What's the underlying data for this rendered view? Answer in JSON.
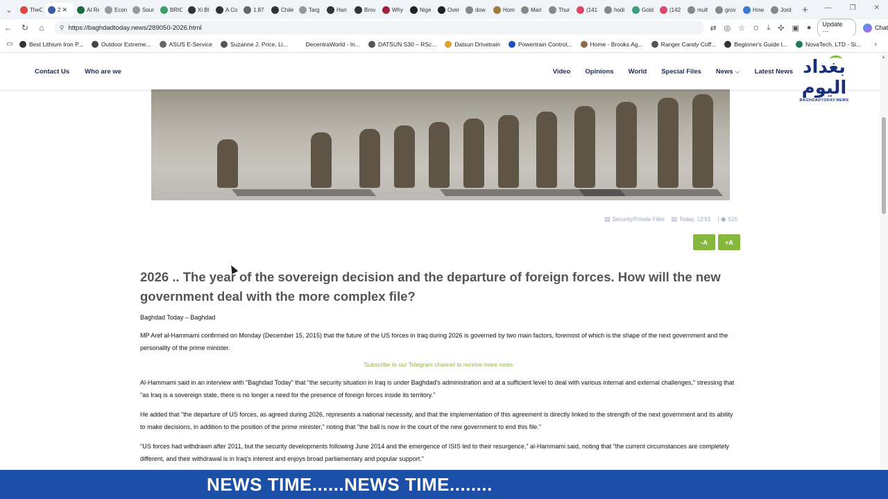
{
  "browser": {
    "tabs": [
      {
        "label": "TheC",
        "icon": "z-icon",
        "color": "#e0453b"
      },
      {
        "label": "2",
        "icon": "site-icon",
        "color": "#3a5aa8",
        "active": true
      },
      {
        "label": "AI Re",
        "icon": "ai-icon",
        "color": "#1d6b3a"
      },
      {
        "label": "Econ",
        "icon": "loading-icon",
        "color": "#999999"
      },
      {
        "label": "Sour",
        "icon": "loading-icon",
        "color": "#999999"
      },
      {
        "label": "BRIC",
        "icon": "globe-icon",
        "color": "#39a06a"
      },
      {
        "label": "Xi Bl",
        "icon": "x-icon",
        "color": "#333333"
      },
      {
        "label": "A Co",
        "icon": "o-icon",
        "color": "#333333"
      },
      {
        "label": "1.87",
        "icon": "globe-icon",
        "color": "#666666"
      },
      {
        "label": "Chile",
        "icon": "o-icon",
        "color": "#333333"
      },
      {
        "label": "Targ",
        "icon": "loading-icon",
        "color": "#999999"
      },
      {
        "label": "Han",
        "icon": "o-icon",
        "color": "#333333"
      },
      {
        "label": "Brov",
        "icon": "o-icon",
        "color": "#333333"
      },
      {
        "label": "Why",
        "icon": "red-icon",
        "color": "#a0203a"
      },
      {
        "label": "Nige",
        "icon": "dark-icon",
        "color": "#222222"
      },
      {
        "label": "Over",
        "icon": "dark-icon",
        "color": "#222222"
      },
      {
        "label": "dow",
        "icon": "search-icon",
        "color": "#888888"
      },
      {
        "label": "Hom",
        "icon": "bird-icon",
        "color": "#a07a3a"
      },
      {
        "label": "Mari",
        "icon": "search-icon",
        "color": "#888888"
      },
      {
        "label": "Thur",
        "icon": "globe-icon",
        "color": "#888888"
      },
      {
        "label": "(141",
        "icon": "youtube-icon",
        "color": "#e0456a"
      },
      {
        "label": "hodi",
        "icon": "search-icon",
        "color": "#888888"
      },
      {
        "label": "Gold",
        "icon": "green-icon",
        "color": "#3aa07a"
      },
      {
        "label": "(142",
        "icon": "youtube-icon",
        "color": "#e0456a"
      },
      {
        "label": "mult",
        "icon": "search-icon",
        "color": "#888888"
      },
      {
        "label": "grov",
        "icon": "search-icon",
        "color": "#888888"
      },
      {
        "label": "How",
        "icon": "blue-icon",
        "color": "#3a7ad0"
      },
      {
        "label": "Jord",
        "icon": "search-icon",
        "color": "#888888"
      }
    ],
    "url": "https://baghdadtoday.news/289050-2026.html",
    "update_label": "Update",
    "chat_label": "Chat",
    "bookmarks": [
      {
        "label": "Best Lithium Iron P...",
        "color": "#333333"
      },
      {
        "label": "Outdoor Extreme...",
        "color": "#444444"
      },
      {
        "label": "ASUS E-Service",
        "color": "#666666"
      },
      {
        "label": "Suzanne J. Price, Li...",
        "color": "#555555"
      },
      {
        "label": "DecentraWorld - In...",
        "color": "#ffffff"
      },
      {
        "label": "DATSUN S30 – RSc...",
        "color": "#555555"
      },
      {
        "label": "Datsun Drivetrain",
        "color": "#e0a030"
      },
      {
        "label": "Powertrain Control...",
        "color": "#2050c0"
      },
      {
        "label": "Home - Brooks Ag...",
        "color": "#8a6a4a"
      },
      {
        "label": "Ranger Candy Coff...",
        "color": "#555555"
      },
      {
        "label": "Beginner's Guide t...",
        "color": "#333333"
      },
      {
        "label": "NovaTech, LTD - Si...",
        "color": "#1a7a5a"
      }
    ]
  },
  "site": {
    "nav_left": [
      "Contact Us",
      "Who are we"
    ],
    "nav_right": [
      "Video",
      "Opinions",
      "World",
      "Special Files",
      "News",
      "Latest News"
    ],
    "logo_arabic": "بغداد اليوم",
    "logo_text": "BAGHDADTODAY.NEWS",
    "meta": {
      "category": "Security/Private Files",
      "time": "Today, 12:51",
      "views": "515"
    },
    "font_minus": "-A",
    "font_plus": "+A",
    "article": {
      "title": "2026 .. The year of the sovereign decision and the departure of foreign forces. How will the new government deal with the more complex file?",
      "byline": "Baghdad Today – Baghdad",
      "p1": "MP Aref al-Hammami confirmed on Monday (December 15, 2015) that the future of the US forces in Iraq during 2026 is governed by two main factors, foremost of which is the shape of the next government and the personality of the prime minister.",
      "telegram": "Subscribe to our Telegram channel to receive more news",
      "p2": "Al-Hammami said in an interview with \"Baghdad Today\" that \"the security situation in Iraq is under Baghdad's administration and at a sufficient level to deal with various internal and external challenges,\" stressing that \"as Iraq is a sovereign state, there is no longer a need for the presence of foreign forces inside its territory.\"",
      "p3": "He added that \"the departure of US forces, as agreed during 2026, represents a national necessity, and that the implementation of this agreement is directly linked to the strength of the next government and its ability to make decisions, in addition to the position of the prime minister,\" noting that \"the ball is now in the court of the new government to end this file.\"",
      "p4": "\"US forces had withdrawn after 2011, but the security developments following June 2014 and the emergence of ISIS led to their resurgence,\" al-Hammami said, noting that \"the current circumstances are completely different, and their withdrawal is in Iraq's interest and enjoys broad parliamentary and popular support.\""
    }
  },
  "ticker": "NEWS TIME......NEWS TIME........",
  "colors": {
    "accent_green": "#86b83d",
    "ticker_blue": "#1c4fa8",
    "nav_text": "#1c2a5a"
  }
}
